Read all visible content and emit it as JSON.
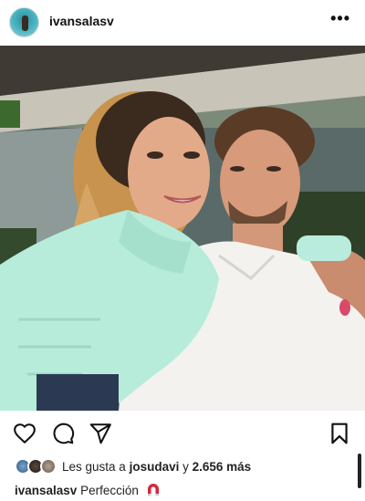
{
  "post": {
    "username": "ivansalasv",
    "more_icon": "more-horizontal-icon",
    "more_glyph": "•••"
  },
  "actions": {
    "like_icon": "heart-icon",
    "comment_icon": "comment-icon",
    "share_icon": "send-icon",
    "save_icon": "bookmark-icon"
  },
  "likes": {
    "prefix": "Les gusta a",
    "user": "josudavi",
    "connector": "y",
    "count_text": "2.656 más"
  },
  "caption": {
    "username": "ivansalasv",
    "text": "Perfección",
    "emoji_icon": "magnet-icon"
  },
  "colors": {
    "text": "#111111",
    "background": "#ffffff",
    "magnet_red": "#d7263d"
  }
}
